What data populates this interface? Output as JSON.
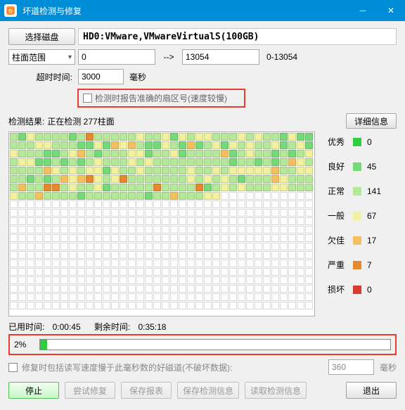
{
  "window": {
    "title": "坏道检测与修复"
  },
  "toolbar": {
    "select_disk": "选择磁盘",
    "disk_name": "HD0:VMware,VMwareVirtualS(100GB)",
    "range_label": "柱面范围",
    "range_from": "0",
    "arrow": "-->",
    "range_to": "13054",
    "range_hint": "0-13054",
    "timeout_label": "超时时间:",
    "timeout_val": "3000",
    "ms_unit": "毫秒",
    "accurate_checkbox": "检测时报告准确的扇区号(速度较慢)"
  },
  "result": {
    "label_prefix": "检测结果:",
    "status": "正在检测 277柱面",
    "details_btn": "详细信息"
  },
  "legend": {
    "excellent": {
      "label": "优秀",
      "color": "#2fcf3d",
      "count": "0"
    },
    "good": {
      "label": "良好",
      "color": "#76d978",
      "count": "45"
    },
    "normal": {
      "label": "正常",
      "color": "#b6e89a",
      "count": "141"
    },
    "fair": {
      "label": "一般",
      "color": "#f2f29e",
      "count": "67"
    },
    "poor": {
      "label": "欠佳",
      "color": "#f3c060",
      "count": "17"
    },
    "severe": {
      "label": "严重",
      "color": "#e58a2c",
      "count": "7"
    },
    "bad": {
      "label": "损坏",
      "color": "#d83a2b",
      "count": "0"
    }
  },
  "colors": {
    "excellent": "#2fcf3d",
    "good": "#76d978",
    "normal": "#b6e89a",
    "fair": "#f2f29e",
    "poor": "#f3c060",
    "severe": "#e58a2c",
    "bad": "#d83a2b",
    "empty": "#ffffff"
  },
  "timing": {
    "elapsed_label": "已用时间:",
    "elapsed": "0:00:45",
    "remain_label": "剩余时间:",
    "remain": "0:35:18"
  },
  "progress": {
    "pct_text": "2%",
    "pct_value": 2
  },
  "repair": {
    "repair_checkbox": "修复时包括读写速度慢于此毫秒数的好磁道(不破坏数据):",
    "repair_ms": "360",
    "ms_unit": "毫秒"
  },
  "buttons": {
    "stop": "停止",
    "try_repair": "尝试修复",
    "save_report": "保存报表",
    "save_info": "保存检测信息",
    "load_info": "读取检测信息",
    "exit": "退出"
  },
  "chart_data": {
    "type": "heatmap",
    "title": "柱面健康状态网格",
    "cols": 36,
    "rows_total": 21,
    "painted_cells": 277,
    "cell_pattern": "ngfnnnngnsnnnnnfnnfgfnffnnnfnfnngfggnnnffnnnggfgpfpnggfngpgnfgfnfnnfgnfgfnnnggnfpngnnnffgnnfgnnnnpgnfnngngnfnffggngngnfnnnfnfnnnnnnnnngnngngnpfnnnnnpfnfnffgfnnfnnnnnfnnfnfffffpnnffnngngnpfpsfnfsnnnnnnnfnfnfngnnnpfnnnnpnnssnfnnfgnnnnnsnnnnsgnfnfnnnffnnnfnnpnnnngnnnnnnngnnpnnnff",
    "legend_keys": {
      "e": "excellent",
      "g": "good",
      "n": "normal",
      "f": "fair",
      "p": "poor",
      "s": "severe",
      "b": "bad"
    }
  }
}
